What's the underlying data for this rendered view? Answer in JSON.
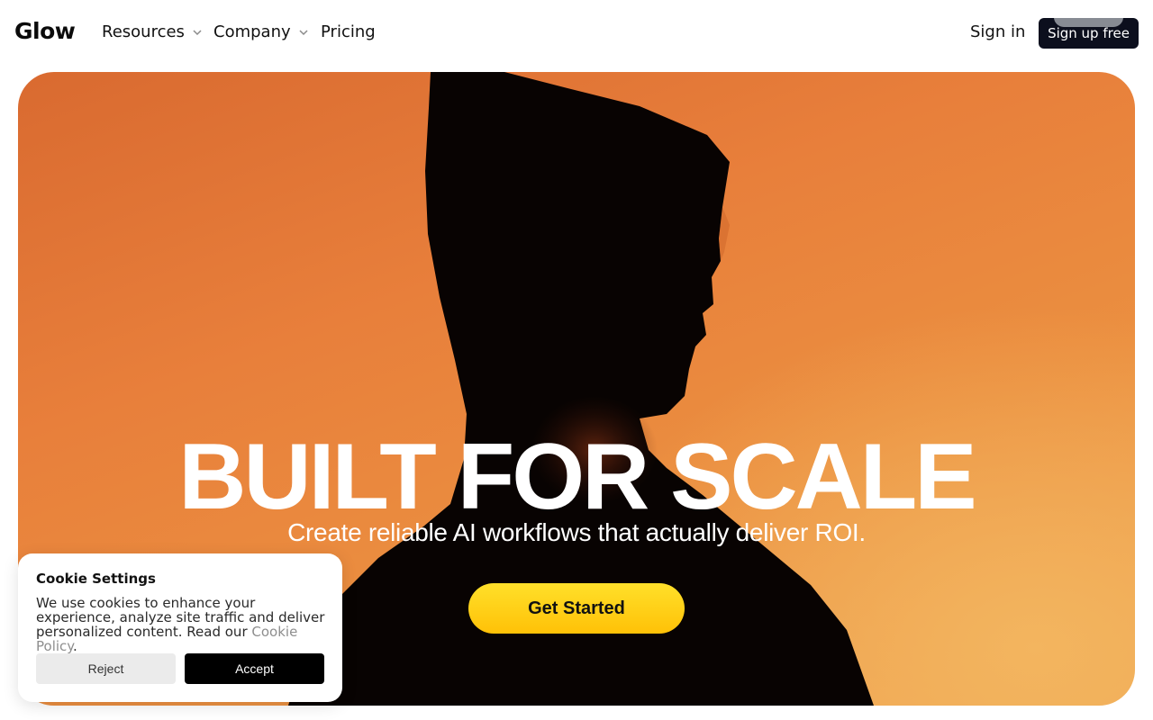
{
  "brand": {
    "logo_text": "Glow"
  },
  "nav": {
    "items": [
      {
        "label": "Resources",
        "has_dropdown": true
      },
      {
        "label": "Company",
        "has_dropdown": true
      },
      {
        "label": "Pricing",
        "has_dropdown": false
      }
    ],
    "sign_in": "Sign in",
    "sign_up": "Sign up free"
  },
  "hero": {
    "headline": "BUILT FOR SCALE",
    "subheadline": "Create reliable AI workflows that actually deliver ROI.",
    "cta_label": "Get Started"
  },
  "cookie": {
    "title": "Cookie Settings",
    "text": "We use cookies to enhance your experience, analyze site traffic and deliver personalized content. Read our ",
    "link_text": "Cookie Policy",
    "text_end": ".",
    "reject_label": "Reject",
    "accept_label": "Accept"
  },
  "colors": {
    "hero_orange": "#e87f3b",
    "cta_yellow": "#ffd21a",
    "signup_bg": "#0c0f1d"
  }
}
